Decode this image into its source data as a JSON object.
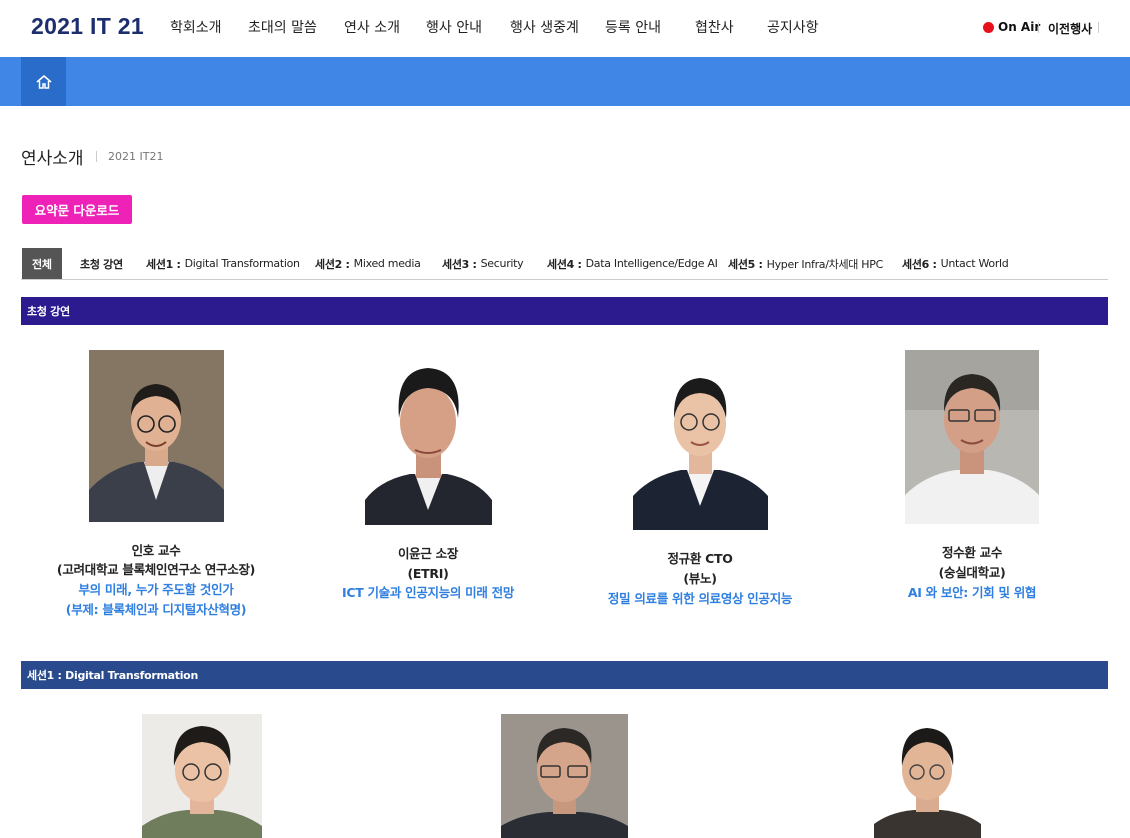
{
  "header": {
    "logo": "2021 IT 21",
    "nav": [
      "학회소개",
      "초대의 말씀",
      "연사 소개",
      "행사 안내",
      "행사 생중계",
      "등록 안내",
      "협찬사",
      "공지사항"
    ],
    "on_air": "On Air",
    "prev_events": "이전행사"
  },
  "page": {
    "title": "연사소개",
    "subtitle": "2021 IT21",
    "download_label": "요약문 다운로드"
  },
  "tabs": [
    {
      "label": "전체"
    },
    {
      "label": "초청 강연"
    },
    {
      "prefix": "세션1 :",
      "label": "Digital Transformation"
    },
    {
      "prefix": "세션2 :",
      "label": "Mixed media"
    },
    {
      "prefix": "세션3 :",
      "label": "Security"
    },
    {
      "prefix": "세션4 :",
      "label": "Data Intelligence/Edge AI"
    },
    {
      "prefix": "세션5 :",
      "label": "Hyper Infra/차세대 HPC"
    },
    {
      "prefix": "세션6 :",
      "label": "Untact World"
    }
  ],
  "sections": {
    "invited": {
      "title": "초청 강연",
      "speakers": [
        {
          "name": "인호 교수",
          "affiliation": "(고려대학교 블록체인연구소 연구소장)",
          "topic": "부의 미래, 누가 주도할 것인가",
          "topic2": "(부제: 블록체인과 디지털자산혁명)"
        },
        {
          "name": "이윤근 소장",
          "affiliation": "(ETRI)",
          "topic": "ICT 기술과 인공지능의 미래 전망"
        },
        {
          "name": "정규환 CTO",
          "affiliation": "(뷰노)",
          "topic": "정밀 의료를 위한 의료영상 인공지능"
        },
        {
          "name": "정수환 교수",
          "affiliation": "(숭실대학교)",
          "topic": "AI 와 보안: 기회 및 위협"
        }
      ]
    },
    "session1": {
      "title": "세션1 : Digital Transformation"
    }
  },
  "colors": {
    "logo": "#1d2e6e",
    "blue_bar": "#3f86e6",
    "download_button": "#ee22b6",
    "invited_bar": "#2b1b8f",
    "session_bar": "#294a8d",
    "topic_link": "#2f7fe0",
    "on_air_dot": "#e8101a"
  }
}
